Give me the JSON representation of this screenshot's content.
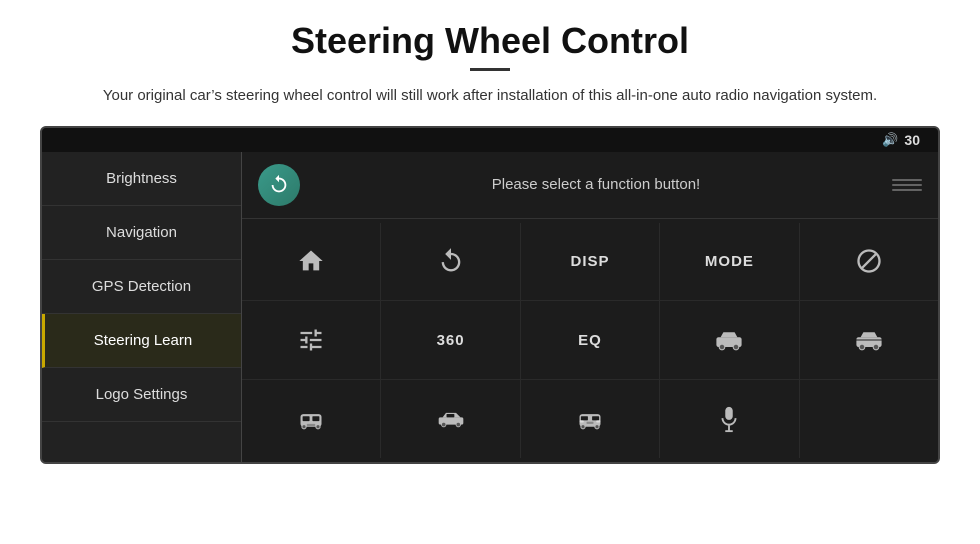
{
  "header": {
    "title": "Steering Wheel Control",
    "subtitle": "Your original car’s steering wheel control will still work after installation of this all-in-one auto radio navigation system."
  },
  "topbar": {
    "volume_icon": "🔊",
    "volume_value": "30"
  },
  "sidebar": {
    "items": [
      {
        "id": "brightness",
        "label": "Brightness",
        "active": false
      },
      {
        "id": "navigation",
        "label": "Navigation",
        "active": false
      },
      {
        "id": "gps-detection",
        "label": "GPS Detection",
        "active": false
      },
      {
        "id": "steering-learn",
        "label": "Steering Learn",
        "active": true
      },
      {
        "id": "logo-settings",
        "label": "Logo Settings",
        "active": false
      }
    ]
  },
  "main": {
    "refresh_button_label": "refresh",
    "function_prompt": "Please select a function button!",
    "grid": {
      "row1": [
        {
          "id": "home",
          "type": "icon",
          "label": "Home"
        },
        {
          "id": "back",
          "type": "icon",
          "label": "Back"
        },
        {
          "id": "disp",
          "type": "text",
          "label": "DISP"
        },
        {
          "id": "mode",
          "type": "text",
          "label": "MODE"
        },
        {
          "id": "phone-reject",
          "type": "icon",
          "label": "Phone Reject"
        }
      ],
      "row2": [
        {
          "id": "tune",
          "type": "icon",
          "label": "Tune"
        },
        {
          "id": "360",
          "type": "text",
          "label": "360"
        },
        {
          "id": "eq",
          "type": "text",
          "label": "EQ"
        },
        {
          "id": "car1",
          "type": "icon",
          "label": "Car View 1"
        },
        {
          "id": "car2",
          "type": "icon",
          "label": "Car View 2"
        }
      ],
      "row3": [
        {
          "id": "car-front",
          "type": "icon",
          "label": "Car Front"
        },
        {
          "id": "car-side",
          "type": "icon",
          "label": "Car Side"
        },
        {
          "id": "car-rear",
          "type": "icon",
          "label": "Car Rear"
        },
        {
          "id": "mic",
          "type": "icon",
          "label": "Microphone"
        },
        {
          "id": "empty",
          "type": "empty",
          "label": ""
        }
      ]
    }
  }
}
